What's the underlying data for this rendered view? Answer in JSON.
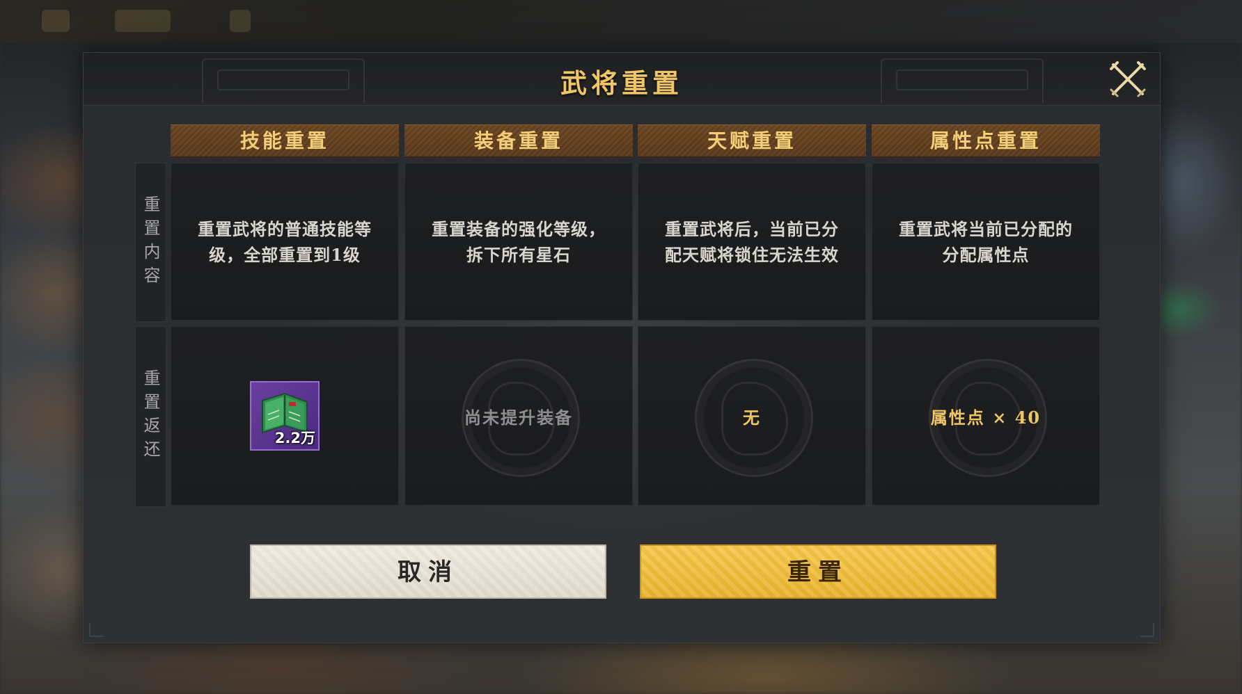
{
  "dialog": {
    "title": "武将重置",
    "close_icon": "close-crossed-swords-icon"
  },
  "columns": [
    {
      "header": "技能重置",
      "description": "重置武将的普通技能等级，全部重置到1级"
    },
    {
      "header": "装备重置",
      "description": "重置装备的强化等级，拆下所有星石"
    },
    {
      "header": "天赋重置",
      "description": "重置武将后，当前已分配天赋将锁住无法生效"
    },
    {
      "header": "属性点重置",
      "description": "重置武将当前已分配的分配属性点"
    }
  ],
  "row_labels": {
    "content": "重置内容",
    "refund": "重置返还"
  },
  "refunds": {
    "skill": {
      "item_icon": "skill-book-icon",
      "count": "2.2万"
    },
    "equipment": "尚未提升装备",
    "talent": "无",
    "attribute": "属性点 × 40"
  },
  "buttons": {
    "cancel": "取消",
    "reset": "重置"
  },
  "colors": {
    "gold": "#f0c566",
    "header_brown": "#5b3a1b",
    "reset_button": "#f5c94f",
    "cancel_button": "#ece6db"
  }
}
